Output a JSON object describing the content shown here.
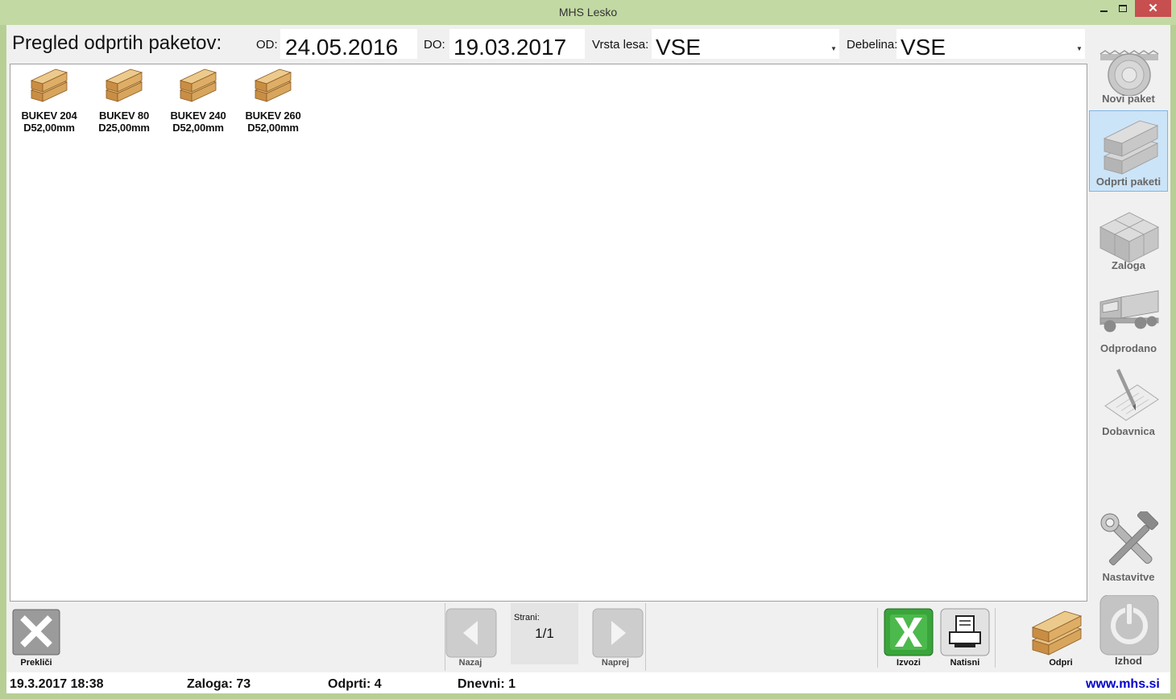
{
  "window": {
    "title": "MHS Lesko",
    "close_glyph": "✕"
  },
  "header": {
    "title": "Pregled odprtih paketov:",
    "od_label": "OD:",
    "od_value": "24.05.2016",
    "do_label": "DO:",
    "do_value": "19.03.2017",
    "vrsta_label": "Vrsta lesa:",
    "vrsta_value": "VSE",
    "debelina_label": "Debelina:",
    "debelina_value": "VSE"
  },
  "packages": [
    {
      "line1": "BUKEV 204",
      "line2": "D52,00mm"
    },
    {
      "line1": "BUKEV 80",
      "line2": "D25,00mm"
    },
    {
      "line1": "BUKEV 240",
      "line2": "D52,00mm"
    },
    {
      "line1": "BUKEV 260",
      "line2": "D52,00mm"
    }
  ],
  "sidebar": {
    "items": [
      {
        "label": "Novi paket",
        "icon": "saw-blade-icon",
        "active": false
      },
      {
        "label": "Odprti paketi",
        "icon": "open-packages-icon",
        "active": true
      },
      {
        "label": "Zaloga",
        "icon": "stock-icon",
        "active": false
      },
      {
        "label": "Odprodano",
        "icon": "truck-icon",
        "active": false
      },
      {
        "label": "Dobavnica",
        "icon": "delivery-note-icon",
        "active": false
      }
    ],
    "settings_label": "Nastavitve",
    "exit_label": "Izhod"
  },
  "bottom": {
    "cancel_label": "Prekliči",
    "back_label": "Nazaj",
    "forward_label": "Naprej",
    "pages_label": "Strani:",
    "pages_value": "1/1",
    "export_label": "Izvozi",
    "print_label": "Natisni",
    "open_label": "Odpri"
  },
  "status": {
    "datetime": "19.3.2017 18:38",
    "zaloga": "Zaloga: 73",
    "odprti": "Odprti: 4",
    "dnevni": "Dnevni: 1",
    "website": "www.mhs.si"
  },
  "colors": {
    "frame": "#b7cf95",
    "active_nav": "#cce4f7",
    "close_button": "#c74f4f",
    "link": "#0000cc"
  }
}
